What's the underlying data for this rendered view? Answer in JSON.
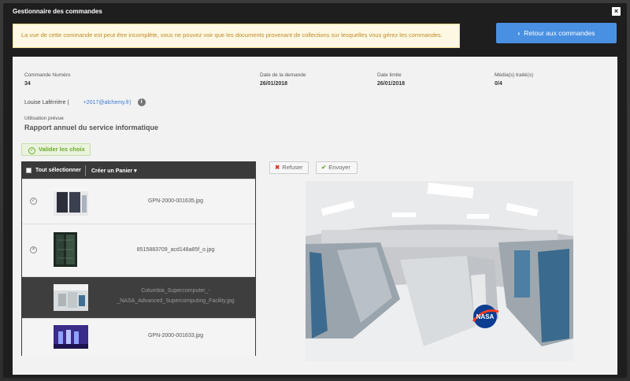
{
  "window": {
    "title": "Gestionnaire des commandes",
    "close_symbol": "×"
  },
  "warning": {
    "text": "La vue de cette commande est peut être incomplète, vous ne pouvez voir que les documents provenant de collections sur lesquelles vous gérez les commandes."
  },
  "back_button": {
    "label": "Retour aux commandes",
    "icon": "chevron-left-icon"
  },
  "order": {
    "number_label": "Commande Numéro",
    "number": "34",
    "date_label": "Date de la demande",
    "date": "26/01/2018",
    "deadline_label": "Date limite",
    "deadline": "26/01/2018",
    "media_label": "Média(s) traité(s)",
    "media": "0/4",
    "requester_name": "Louise Laférrière (",
    "requester_email": "+2017@alchemy.fr)",
    "usage_label": "Utilisation prévue",
    "usage": "Rapport annuel du service informatique"
  },
  "actions": {
    "validate_label": "Valider les choix",
    "refuse_label": "Refuser",
    "send_label": "Envoyer"
  },
  "list": {
    "select_all_label": "Tout sélectionner",
    "basket_label": "Créer un Panier ▾",
    "items": [
      {
        "filename": "GPN-2000-001635.jpg",
        "status": "accepted"
      },
      {
        "filename": "8515883709_acd148a85f_o.jpg",
        "status": "refused"
      },
      {
        "filename": "Columbia_Supercomputer_-_NASA_Advanced_Supercomputing_Facility.jpg",
        "status": "none",
        "line1": "Columbia_Supercomputer_-",
        "line2": "_NASA_Advanced_Supercomputing_Facility.jpg"
      },
      {
        "filename": "GPN-2000-001633.jpg",
        "status": "none"
      }
    ]
  },
  "preview": {
    "logo_text": "NASA"
  },
  "colors": {
    "accent": "#4a90e2",
    "success": "#6aaa2a",
    "danger": "#d9342b",
    "warning_text": "#c08a2b"
  }
}
